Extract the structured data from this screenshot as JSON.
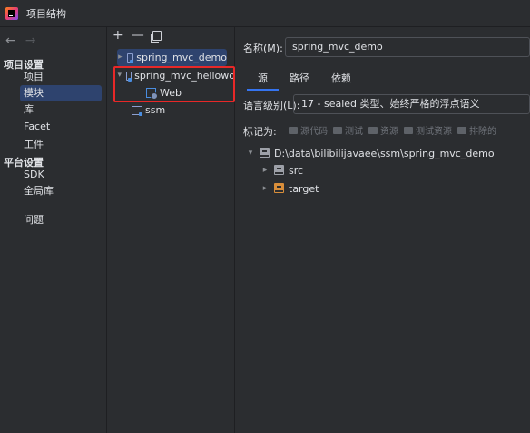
{
  "window": {
    "title": "项目结构"
  },
  "nav": {
    "back": "←",
    "forward": "→",
    "sections": [
      {
        "title": "项目设置",
        "items": [
          "项目",
          "模块",
          "库",
          "Facet",
          "工件"
        ]
      },
      {
        "title": "平台设置",
        "items": [
          "SDK",
          "全局库"
        ]
      }
    ],
    "problems": "问题",
    "selected": "模块"
  },
  "modules": {
    "toolbar": {
      "add": "+",
      "remove": "—"
    },
    "tree": [
      {
        "name": "spring_mvc_demo",
        "expanded": false,
        "selected": true
      },
      {
        "name": "spring_mvc_hellowo",
        "expanded": true,
        "selected": false,
        "children": [
          {
            "name": "Web"
          }
        ]
      },
      {
        "name": "ssm",
        "expanded": false,
        "selected": false
      }
    ]
  },
  "detail": {
    "name_label": "名称(M):",
    "name_value": "spring_mvc_demo",
    "tabs": [
      "源",
      "路径",
      "依赖"
    ],
    "active_tab": "源",
    "language_level_label": "语言级别(L):",
    "language_level_value": "17 - sealed 类型、始终严格的浮点语义",
    "mark_as_label": "标记为:",
    "mark_as_options": [
      "源代码",
      "测试",
      "资源",
      "测试资源",
      "排除的"
    ],
    "content_root": "D:\\data\\bilibilijavaee\\ssm\\spring_mvc_demo",
    "folders": [
      "src",
      "target"
    ]
  },
  "colors": {
    "accent": "#3574f0",
    "selection": "#2e436e",
    "highlight_box": "#e82828"
  }
}
